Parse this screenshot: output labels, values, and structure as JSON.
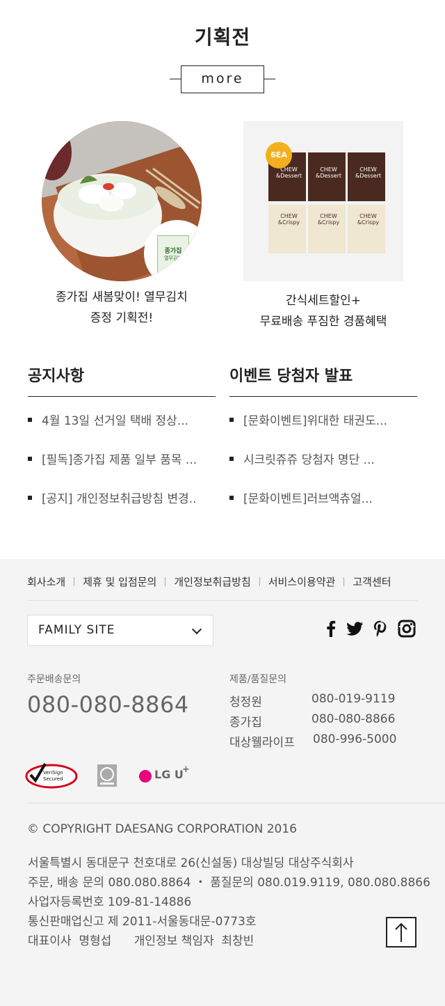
{
  "promo": {
    "title": "기획전",
    "more_label": "more",
    "items": [
      {
        "line1": "종가집 새봄맞이! 열무김치",
        "line2": "증정 기획전!",
        "badge_brand": "종가집",
        "badge_text": "열무김치"
      },
      {
        "line1": "간식세트할인+",
        "line2": "무료배송 푸짐한 경품혜택",
        "badge": "6EA",
        "pack_top": "CHEW &Dessert",
        "pack_bottom": "CHEW &Crispy"
      }
    ]
  },
  "notice": {
    "title": "공지사항",
    "items": [
      "4월 13일 선거일 택배 정상...",
      "[필독]종가집 제품 일부 품목 ...",
      "[공지] 개인정보취급방침 변경.."
    ]
  },
  "event": {
    "title": "이벤트 당첨자 발표",
    "items": [
      "[문화이벤트]위대한 태권도...",
      "시크릿쥬쥬 당첨자 명단 ...",
      "[문화이벤트]러브액츄얼..."
    ]
  },
  "footer": {
    "links": [
      "회사소개",
      "제휴 및 입점문의",
      "개인정보취급방침",
      "서비스이용약관",
      "고객센터"
    ],
    "family_site": "FAMILY SITE",
    "order_label": "주문배송문의",
    "order_tel": "080-080-8864",
    "quality_label": "제품/품질문의",
    "quality_contacts": [
      {
        "name": "청정원",
        "tel": "080-019-9119"
      },
      {
        "name": "종가집",
        "tel": "080-080-8866"
      },
      {
        "name": "대상웰라이프",
        "tel": "080-996-5000"
      }
    ],
    "certs": {
      "verisign_line1": "VeriSign",
      "verisign_line2": "Secured",
      "lg": "LG U"
    },
    "copyright": "© COPYRIGHT DAESANG CORPORATION 2016",
    "address_lines": [
      "서울특별시 동대문구 천호대로 26(신설동) 대상빌딩 대상주식회사",
      "주문, 배송 문의 080.080.8864 ・ 품질문의 080.019.9119, 080.080.8866",
      "사업자등록번호 109-81-14886",
      "통신판매업신고 제 2011-서울동대문-0773호",
      "대표이사  명형섭      개인정보 책임자  최창빈"
    ]
  },
  "colors": {
    "text_dark": "#222222",
    "text_gray": "#555555",
    "footer_bg": "#f4f4f4",
    "verisign_red": "#d6001c",
    "lg_pink": "#e6007e",
    "pack_dark": "#4a2a20",
    "pack_light": "#efe7d2",
    "badge_yellow": "#f2b01e"
  }
}
